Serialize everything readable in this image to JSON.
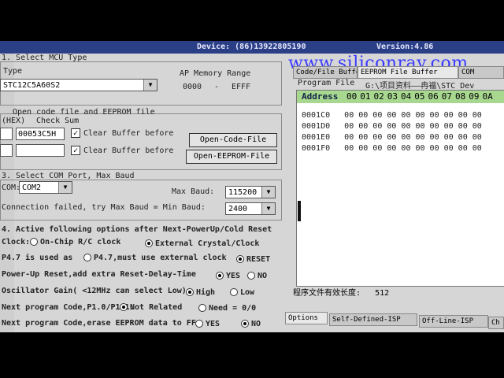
{
  "window": {
    "device_text": "Device: (86)13922805190",
    "version": "Version:4.86"
  },
  "watermark": "www.siliconray.com",
  "mcu": {
    "section_title": "1. Select MCU Type",
    "type_label": "Type",
    "selected": "STC12C5A60S2",
    "ap_range_label": "AP Memory Range",
    "range_start": "0000",
    "range_sep": "-",
    "range_end": "EFFF"
  },
  "file_section": {
    "title": "Open code file and EEPROM file",
    "hex_label": "(HEX)",
    "checksum_label": "Check Sum",
    "checksum_value": "00053C5H",
    "clear_buffer_1": "Clear Buffer before",
    "clear_buffer_2": "Clear Buffer before",
    "open_code_btn": "Open-Code-File",
    "open_eeprom_btn": "Open-EEPROM-File"
  },
  "com_section": {
    "title": "3. Select COM Port, Max Baud",
    "com_label": "COM:",
    "com_value": "COM2",
    "max_baud_label": "Max Baud:",
    "max_baud_value": "115200",
    "status_text": "Connection failed, try Max Baud = Min Baud:",
    "min_baud_value": "2400"
  },
  "options": {
    "title": "4. Active following options after Next-PowerUp/Cold Reset",
    "clock_label": "Clock:",
    "clock_opt1": "On-Chip R/C clock",
    "clock_opt2": "External Crystal/Clock",
    "p47_label": "P4.7 is used as",
    "p47_opt1": "P4.7,must use external clock",
    "p47_opt2": "RESET",
    "powerup_label": "Power-Up Reset,add extra Reset-Delay-Time",
    "powerup_yes": "YES",
    "powerup_no": "NO",
    "gain_label": "Oscillator Gain( <12MHz can select Low):",
    "gain_high": "High",
    "gain_low": "Low",
    "next_prog_label": "Next program Code,P1.0/P1.1:",
    "next_not_related": "Not Related",
    "next_need": "Need = 0/0",
    "erase_label": "Next program Code,erase EEPROM data to FF:",
    "erase_yes": "YES",
    "erase_no": "NO"
  },
  "right_tabs": [
    "Code/File Buffer",
    "EEPROM File Buffer",
    "COM"
  ],
  "program_file_label": "Program File",
  "program_file_path": "G:\\项目资料——冉福\\STC Dev",
  "hex": {
    "address_header": "Address",
    "columns": [
      "00",
      "01",
      "02",
      "03",
      "04",
      "05",
      "06",
      "07",
      "08",
      "09",
      "0A"
    ],
    "rows": [
      {
        "addr": "0001C0",
        "bytes": "00 00 00 00 00 00 00 00 00 00"
      },
      {
        "addr": "0001D0",
        "bytes": "00 00 00 00 00 00 00 00 00 00"
      },
      {
        "addr": "0001E0",
        "bytes": "00 00 00 00 00 00 00 00 00 00"
      },
      {
        "addr": "0001F0",
        "bytes": "00 00 00 00 00 00 00 00 00 00"
      }
    ]
  },
  "file_length_label": "程序文件有效长度:",
  "file_length_value": "512",
  "bottom_tabs": [
    "Options",
    "Self-Defined-ISP",
    "Off-Line-ISP",
    "Ch"
  ]
}
